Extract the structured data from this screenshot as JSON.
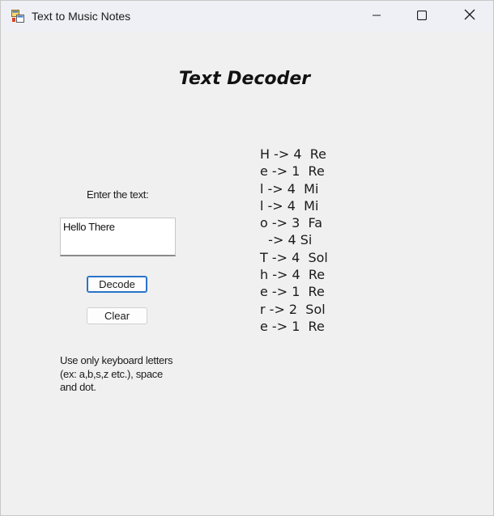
{
  "window": {
    "title": "Text to Music Notes",
    "icon": "app-window-icon",
    "controls": [
      "minimize-icon",
      "maximize-icon",
      "close-icon"
    ]
  },
  "main": {
    "heading": "Text Decoder",
    "prompt_label": "Enter the text:",
    "input_value": "Hello There",
    "decode_label": "Decode",
    "clear_label": "Clear",
    "hint": "Use only keyboard letters (ex: a,b,s,z etc.), space and dot."
  },
  "output": {
    "lines": [
      "H -> 4  Re",
      "e -> 1  Re",
      "l -> 4  Mi",
      "l -> 4  Mi",
      "o -> 3  Fa",
      "  -> 4 Si",
      "T -> 4  Sol",
      "h -> 4  Re",
      "e -> 1  Re",
      "r -> 2  Sol",
      "e -> 1  Re"
    ]
  },
  "colors": {
    "window_bg": "#f0f0f0",
    "titlebar_bg": "#eef0f5",
    "accent": "#2a73c8"
  }
}
